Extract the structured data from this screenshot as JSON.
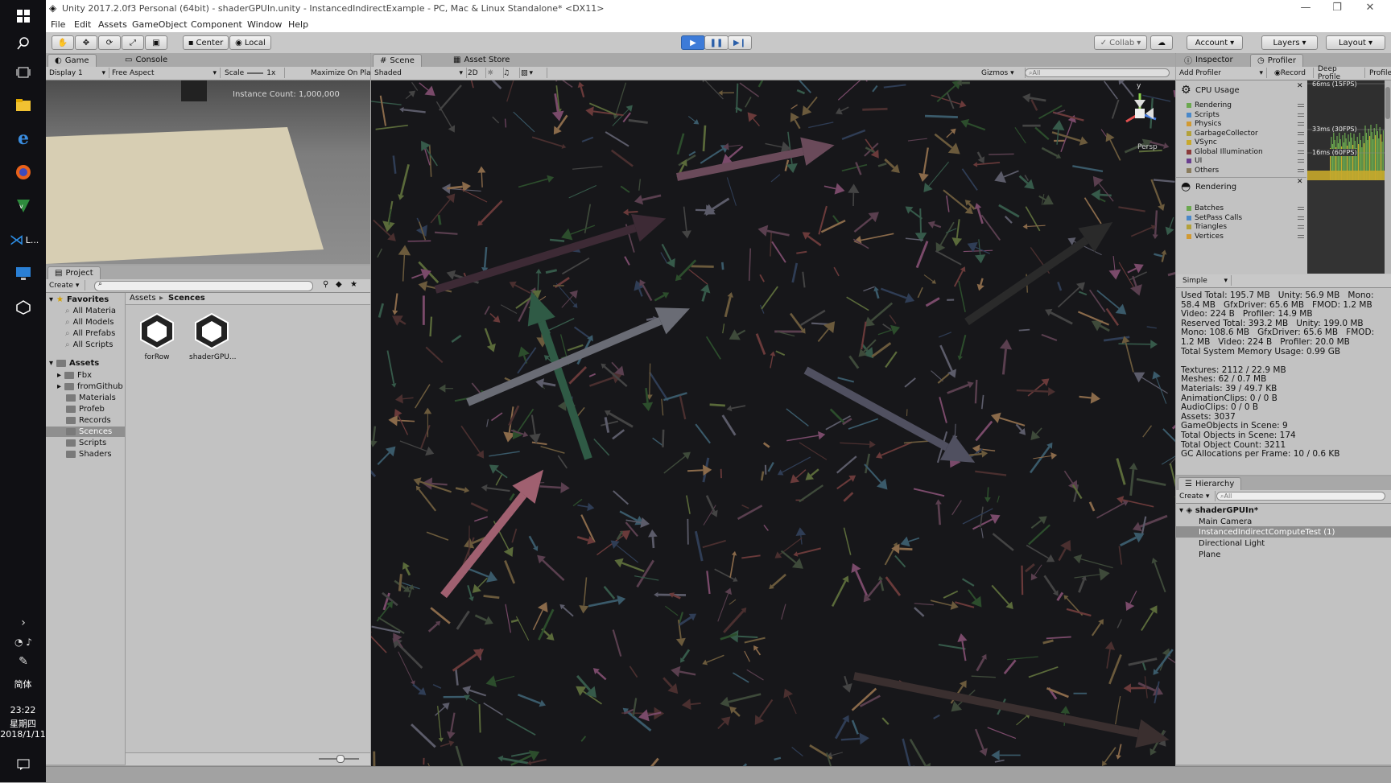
{
  "taskbar": {
    "time": "23:22",
    "weekday": "星期四",
    "date": "2018/1/11",
    "ime": "简体",
    "vscode_label": "L..."
  },
  "window": {
    "title": "Unity 2017.2.0f3 Personal (64bit) - shaderGPUIn.unity - InstancedIndirectExample - PC, Mac & Linux Standalone* <DX11>"
  },
  "menu": [
    "File",
    "Edit",
    "Assets",
    "GameObject",
    "Component",
    "Window",
    "Help"
  ],
  "toolbar": {
    "pivot": "Center",
    "space": "Local",
    "collab": "Collab",
    "account": "Account",
    "layers": "Layers",
    "layout": "Layout"
  },
  "game": {
    "tab_game": "Game",
    "tab_console": "Console",
    "display": "Display 1",
    "aspect": "Free Aspect",
    "scale_label": "Scale",
    "scale_value": "1x",
    "maximize": "Maximize On Pla",
    "instance_count": "Instance Count: 1,000,000"
  },
  "scene": {
    "tab_scene": "Scene",
    "tab_store": "Asset Store",
    "shading": "Shaded",
    "mode_2d": "2D",
    "gizmos": "Gizmos",
    "search_placeholder": "All",
    "persp": "Persp",
    "axis_y": "y"
  },
  "project": {
    "tab": "Project",
    "create": "Create",
    "favorites_label": "Favorites",
    "favorites": [
      "All Materia",
      "All Models",
      "All Prefabs",
      "All Scripts"
    ],
    "assets_label": "Assets",
    "folders": [
      "Fbx",
      "fromGithub",
      "Materials",
      "Profeb",
      "Records",
      "Scences",
      "Scripts",
      "Shaders"
    ],
    "breadcrumb": [
      "Assets",
      "Scences"
    ],
    "files": [
      "forRow",
      "shaderGPU..."
    ]
  },
  "inspector": {
    "tab_inspector": "Inspector",
    "tab_profiler": "Profiler",
    "add_profiler": "Add Profiler",
    "record": "Record",
    "deep_profile": "Deep Profile",
    "profile_cut": "Profile",
    "cpu_title": "CPU Usage",
    "cpu_items": [
      {
        "label": "Rendering",
        "color": "#6ba84f"
      },
      {
        "label": "Scripts",
        "color": "#4a88c9"
      },
      {
        "label": "Physics",
        "color": "#d19a33"
      },
      {
        "label": "GarbageCollector",
        "color": "#b3a13a"
      },
      {
        "label": "VSync",
        "color": "#c8a92b"
      },
      {
        "label": "Global Illumination",
        "color": "#8b3b3b"
      },
      {
        "label": "UI",
        "color": "#6a3e8f"
      },
      {
        "label": "Others",
        "color": "#8a7c5c"
      }
    ],
    "rendering_title": "Rendering",
    "rendering_items": [
      {
        "label": "Batches",
        "color": "#6ba84f"
      },
      {
        "label": "SetPass Calls",
        "color": "#4a88c9"
      },
      {
        "label": "Triangles",
        "color": "#b3a13a"
      },
      {
        "label": "Vertices",
        "color": "#d19a33"
      }
    ],
    "graph_labels": [
      "66ms (15FPS)",
      "33ms (30FPS)",
      "16ms (60FPS)"
    ],
    "mode": "Simple",
    "stats": "Used Total: 195.7 MB   Unity: 56.9 MB   Mono:\n58.4 MB   GfxDriver: 65.6 MB   FMOD: 1.2 MB\nVideo: 224 B   Profiler: 14.9 MB\nReserved Total: 393.2 MB   Unity: 199.0 MB\nMono: 108.6 MB   GfxDriver: 65.6 MB   FMOD:\n1.2 MB   Video: 224 B   Profiler: 20.0 MB\nTotal System Memory Usage: 0.99 GB\n\nTextures: 2112 / 22.9 MB\nMeshes: 62 / 0.7 MB\nMaterials: 39 / 49.7 KB\nAnimationClips: 0 / 0 B\nAudioClips: 0 / 0 B\nAssets: 3037\nGameObjects in Scene: 9\nTotal Objects in Scene: 174\nTotal Object Count: 3211\nGC Allocations per Frame: 10 / 0.6 KB"
  },
  "hierarchy": {
    "tab": "Hierarchy",
    "create": "Create",
    "search_placeholder": "All",
    "scene_name": "shaderGPUIn*",
    "items": [
      "Main Camera",
      "InstancedIndirectComputeTest (1)",
      "Directional Light",
      "Plane"
    ]
  }
}
